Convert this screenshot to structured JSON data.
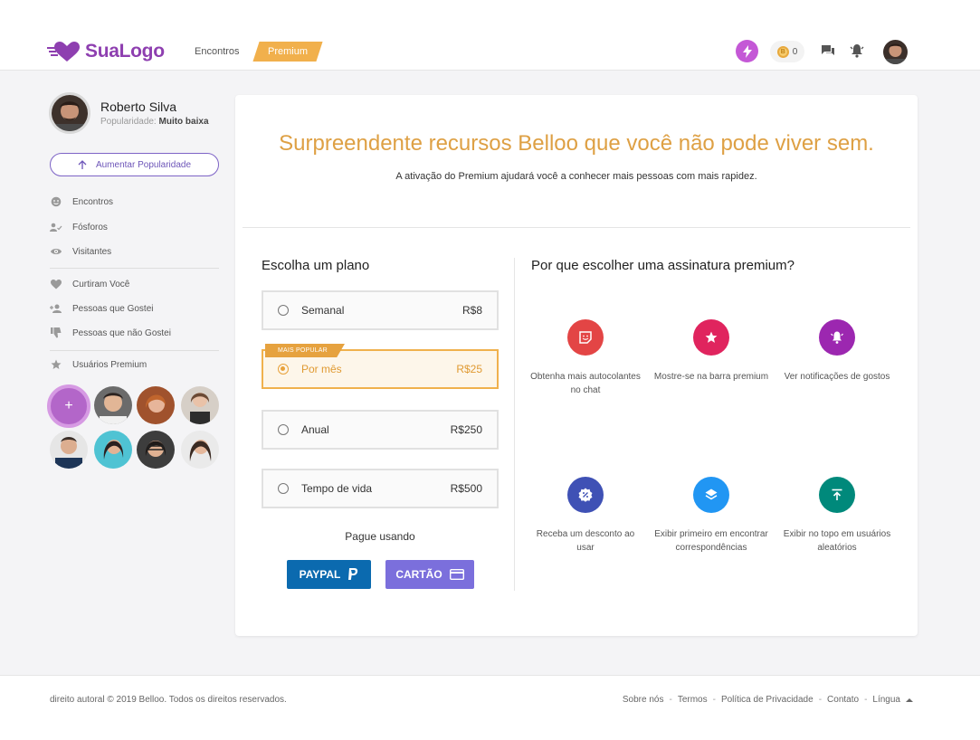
{
  "header": {
    "logo_text": "SuaLogo",
    "nav": {
      "encontros": "Encontros",
      "premium": "Premium"
    },
    "coins": "0",
    "coin_symbol": "B",
    "icons": {
      "boost": "lightning-icon",
      "chat": "chat-icon",
      "bell": "bell-icon"
    },
    "brand_color": "#8e3fb0",
    "premium_color": "#f1b04c"
  },
  "sidebar": {
    "profile": {
      "name": "Roberto Silva",
      "popularity_label": "Popularidade:",
      "popularity_value": "Muito baixa"
    },
    "boost_button": "Aumentar Popularidade",
    "menu": [
      {
        "label": "Encontros",
        "icon": "smile-icon"
      },
      {
        "label": "Fósforos",
        "icon": "users-check-icon"
      },
      {
        "label": "Visitantes",
        "icon": "eye-icon"
      },
      {
        "label": "Curtiram Você",
        "icon": "heart-icon"
      },
      {
        "label": "Pessoas que Gostei",
        "icon": "user-plus-icon"
      },
      {
        "label": "Pessoas que não Gostei",
        "icon": "thumbs-down-icon"
      },
      {
        "label": "Usuários Premium",
        "icon": "star-icon"
      }
    ],
    "add_symbol": "+"
  },
  "main": {
    "title": "Surpreendente recursos Belloo que você não pode viver sem.",
    "subtitle": "A ativação do Premium ajudará você a conhecer mais pessoas com mais rapidez.",
    "plans_title": "Escolha um plano",
    "plans": [
      {
        "name": "Semanal",
        "price": "R$8",
        "selected": false
      },
      {
        "name": "Por mês",
        "price": "R$25",
        "selected": true,
        "tag": "MAIS POPULAR"
      },
      {
        "name": "Anual",
        "price": "R$250",
        "selected": false
      },
      {
        "name": "Tempo de vida",
        "price": "R$500",
        "selected": false
      }
    ],
    "pay_using": "Pague usando",
    "pay_buttons": {
      "paypal": "PAYPAL",
      "card": "CARTÃO"
    },
    "why_title": "Por que escolher uma assinatura premium?",
    "features": [
      {
        "text": "Obtenha mais autocolantes no chat",
        "icon": "sticker-icon",
        "color": "#e34545"
      },
      {
        "text": "Mostre-se na barra premium",
        "icon": "star-icon",
        "color": "#e0245e"
      },
      {
        "text": "Ver notificações de gostos",
        "icon": "bell-ring-icon",
        "color": "#9c27b0"
      },
      {
        "text": "Receba um desconto ao usar",
        "icon": "discount-icon",
        "color": "#3f51b5"
      },
      {
        "text": "Exibir primeiro em encontrar correspondências",
        "icon": "layers-icon",
        "color": "#2196f3"
      },
      {
        "text": "Exibir no topo em usuários aleatórios",
        "icon": "arrow-top-icon",
        "color": "#00897b"
      }
    ]
  },
  "footer": {
    "copyright": "direito autoral © 2019 Belloo. Todos os direitos reservados.",
    "links": [
      "Sobre nós",
      "Termos",
      "Política de Privacidade",
      "Contato",
      "Língua"
    ],
    "separator": "-"
  }
}
